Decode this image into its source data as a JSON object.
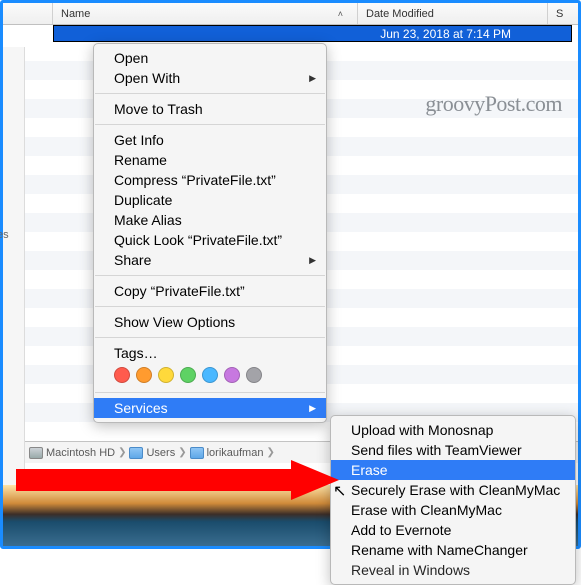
{
  "header": {
    "name_label": "Name",
    "date_label": "Date Modified",
    "s_label": "S"
  },
  "selected_file": {
    "date": "Jun 23, 2018 at 7:14 PM"
  },
  "watermark": "groovyPost.com",
  "sidebar_fragment": "es",
  "ctx": {
    "open": "Open",
    "open_with": "Open With",
    "move_trash": "Move to Trash",
    "get_info": "Get Info",
    "rename": "Rename",
    "compress": "Compress “PrivateFile.txt”",
    "duplicate": "Duplicate",
    "make_alias": "Make Alias",
    "quick_look": "Quick Look “PrivateFile.txt”",
    "share": "Share",
    "copy": "Copy “PrivateFile.txt”",
    "show_view": "Show View Options",
    "tags": "Tags…",
    "services": "Services"
  },
  "tag_colors": [
    "#ff5b4d",
    "#ff9b2f",
    "#ffd93b",
    "#5ed264",
    "#4ab8ff",
    "#c778e0",
    "#a3a3a8"
  ],
  "sub": {
    "upload": "Upload with Monosnap",
    "send": "Send files with TeamViewer",
    "erase": "Erase",
    "sec_erase": "Securely Erase with CleanMyMac",
    "erase_cmm": "Erase with CleanMyMac",
    "evernote": "Add to Evernote",
    "namechanger": "Rename with NameChanger",
    "reveal": "Reveal in Windows"
  },
  "path": {
    "hd": "Macintosh HD",
    "users": "Users",
    "user": "lorikaufman"
  }
}
